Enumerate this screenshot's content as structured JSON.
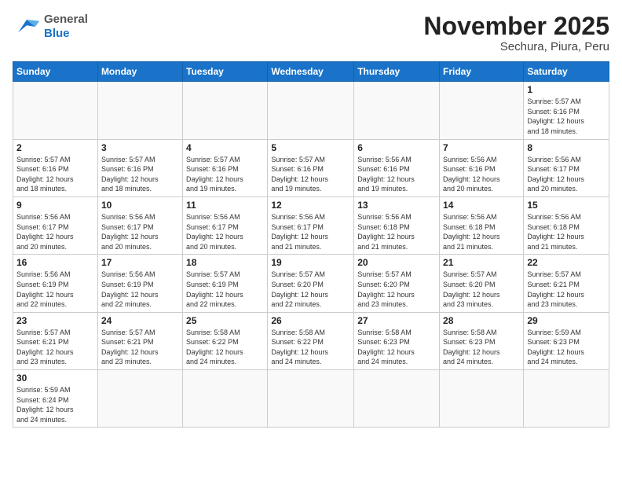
{
  "header": {
    "logo_general": "General",
    "logo_blue": "Blue",
    "title": "November 2025",
    "subtitle": "Sechura, Piura, Peru"
  },
  "weekdays": [
    "Sunday",
    "Monday",
    "Tuesday",
    "Wednesday",
    "Thursday",
    "Friday",
    "Saturday"
  ],
  "weeks": [
    [
      {
        "day": "",
        "info": ""
      },
      {
        "day": "",
        "info": ""
      },
      {
        "day": "",
        "info": ""
      },
      {
        "day": "",
        "info": ""
      },
      {
        "day": "",
        "info": ""
      },
      {
        "day": "",
        "info": ""
      },
      {
        "day": "1",
        "info": "Sunrise: 5:57 AM\nSunset: 6:16 PM\nDaylight: 12 hours\nand 18 minutes."
      }
    ],
    [
      {
        "day": "2",
        "info": "Sunrise: 5:57 AM\nSunset: 6:16 PM\nDaylight: 12 hours\nand 18 minutes."
      },
      {
        "day": "3",
        "info": "Sunrise: 5:57 AM\nSunset: 6:16 PM\nDaylight: 12 hours\nand 18 minutes."
      },
      {
        "day": "4",
        "info": "Sunrise: 5:57 AM\nSunset: 6:16 PM\nDaylight: 12 hours\nand 19 minutes."
      },
      {
        "day": "5",
        "info": "Sunrise: 5:57 AM\nSunset: 6:16 PM\nDaylight: 12 hours\nand 19 minutes."
      },
      {
        "day": "6",
        "info": "Sunrise: 5:56 AM\nSunset: 6:16 PM\nDaylight: 12 hours\nand 19 minutes."
      },
      {
        "day": "7",
        "info": "Sunrise: 5:56 AM\nSunset: 6:16 PM\nDaylight: 12 hours\nand 20 minutes."
      },
      {
        "day": "8",
        "info": "Sunrise: 5:56 AM\nSunset: 6:17 PM\nDaylight: 12 hours\nand 20 minutes."
      }
    ],
    [
      {
        "day": "9",
        "info": "Sunrise: 5:56 AM\nSunset: 6:17 PM\nDaylight: 12 hours\nand 20 minutes."
      },
      {
        "day": "10",
        "info": "Sunrise: 5:56 AM\nSunset: 6:17 PM\nDaylight: 12 hours\nand 20 minutes."
      },
      {
        "day": "11",
        "info": "Sunrise: 5:56 AM\nSunset: 6:17 PM\nDaylight: 12 hours\nand 20 minutes."
      },
      {
        "day": "12",
        "info": "Sunrise: 5:56 AM\nSunset: 6:17 PM\nDaylight: 12 hours\nand 21 minutes."
      },
      {
        "day": "13",
        "info": "Sunrise: 5:56 AM\nSunset: 6:18 PM\nDaylight: 12 hours\nand 21 minutes."
      },
      {
        "day": "14",
        "info": "Sunrise: 5:56 AM\nSunset: 6:18 PM\nDaylight: 12 hours\nand 21 minutes."
      },
      {
        "day": "15",
        "info": "Sunrise: 5:56 AM\nSunset: 6:18 PM\nDaylight: 12 hours\nand 21 minutes."
      }
    ],
    [
      {
        "day": "16",
        "info": "Sunrise: 5:56 AM\nSunset: 6:19 PM\nDaylight: 12 hours\nand 22 minutes."
      },
      {
        "day": "17",
        "info": "Sunrise: 5:56 AM\nSunset: 6:19 PM\nDaylight: 12 hours\nand 22 minutes."
      },
      {
        "day": "18",
        "info": "Sunrise: 5:57 AM\nSunset: 6:19 PM\nDaylight: 12 hours\nand 22 minutes."
      },
      {
        "day": "19",
        "info": "Sunrise: 5:57 AM\nSunset: 6:20 PM\nDaylight: 12 hours\nand 22 minutes."
      },
      {
        "day": "20",
        "info": "Sunrise: 5:57 AM\nSunset: 6:20 PM\nDaylight: 12 hours\nand 23 minutes."
      },
      {
        "day": "21",
        "info": "Sunrise: 5:57 AM\nSunset: 6:20 PM\nDaylight: 12 hours\nand 23 minutes."
      },
      {
        "day": "22",
        "info": "Sunrise: 5:57 AM\nSunset: 6:21 PM\nDaylight: 12 hours\nand 23 minutes."
      }
    ],
    [
      {
        "day": "23",
        "info": "Sunrise: 5:57 AM\nSunset: 6:21 PM\nDaylight: 12 hours\nand 23 minutes."
      },
      {
        "day": "24",
        "info": "Sunrise: 5:57 AM\nSunset: 6:21 PM\nDaylight: 12 hours\nand 23 minutes."
      },
      {
        "day": "25",
        "info": "Sunrise: 5:58 AM\nSunset: 6:22 PM\nDaylight: 12 hours\nand 24 minutes."
      },
      {
        "day": "26",
        "info": "Sunrise: 5:58 AM\nSunset: 6:22 PM\nDaylight: 12 hours\nand 24 minutes."
      },
      {
        "day": "27",
        "info": "Sunrise: 5:58 AM\nSunset: 6:23 PM\nDaylight: 12 hours\nand 24 minutes."
      },
      {
        "day": "28",
        "info": "Sunrise: 5:58 AM\nSunset: 6:23 PM\nDaylight: 12 hours\nand 24 minutes."
      },
      {
        "day": "29",
        "info": "Sunrise: 5:59 AM\nSunset: 6:23 PM\nDaylight: 12 hours\nand 24 minutes."
      }
    ],
    [
      {
        "day": "30",
        "info": "Sunrise: 5:59 AM\nSunset: 6:24 PM\nDaylight: 12 hours\nand 24 minutes."
      },
      {
        "day": "",
        "info": ""
      },
      {
        "day": "",
        "info": ""
      },
      {
        "day": "",
        "info": ""
      },
      {
        "day": "",
        "info": ""
      },
      {
        "day": "",
        "info": ""
      },
      {
        "day": "",
        "info": ""
      }
    ]
  ]
}
